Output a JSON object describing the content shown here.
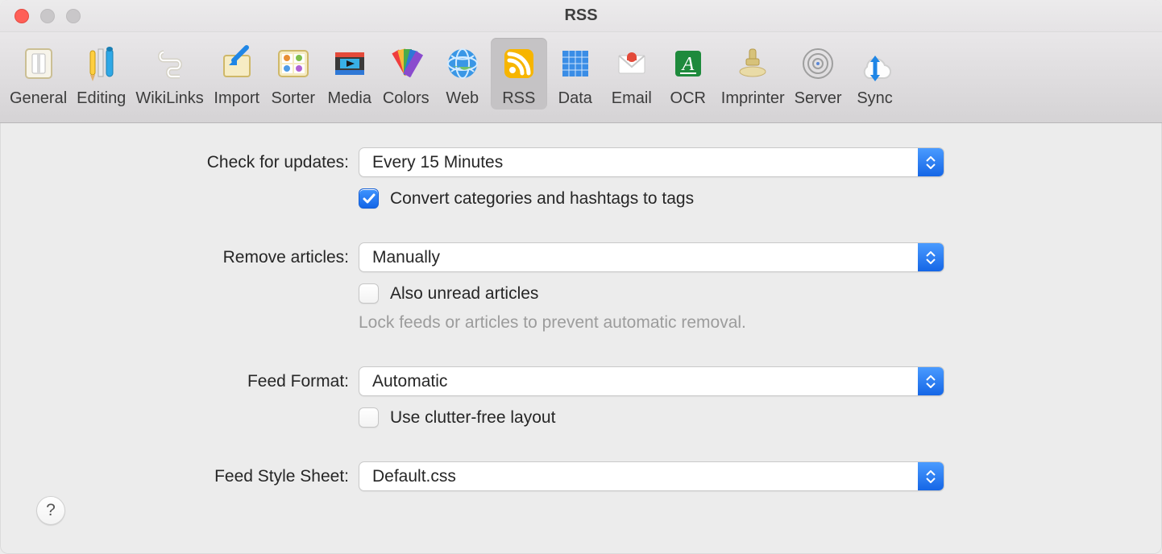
{
  "window": {
    "title": "RSS"
  },
  "toolbar": {
    "items": [
      {
        "id": "general",
        "label": "General"
      },
      {
        "id": "editing",
        "label": "Editing"
      },
      {
        "id": "wikilinks",
        "label": "WikiLinks"
      },
      {
        "id": "import",
        "label": "Import"
      },
      {
        "id": "sorter",
        "label": "Sorter"
      },
      {
        "id": "media",
        "label": "Media"
      },
      {
        "id": "colors",
        "label": "Colors"
      },
      {
        "id": "web",
        "label": "Web"
      },
      {
        "id": "rss",
        "label": "RSS"
      },
      {
        "id": "data",
        "label": "Data"
      },
      {
        "id": "email",
        "label": "Email"
      },
      {
        "id": "ocr",
        "label": "OCR"
      },
      {
        "id": "imprinter",
        "label": "Imprinter"
      },
      {
        "id": "server",
        "label": "Server"
      },
      {
        "id": "sync",
        "label": "Sync"
      }
    ],
    "selected_id": "rss"
  },
  "form": {
    "check_updates": {
      "label": "Check for updates:",
      "value": "Every 15 Minutes"
    },
    "convert_tags": {
      "label": "Convert categories and hashtags to tags",
      "checked": true
    },
    "remove_articles": {
      "label": "Remove articles:",
      "value": "Manually"
    },
    "also_unread": {
      "label": "Also unread articles",
      "checked": false
    },
    "hint": "Lock feeds or articles to prevent automatic removal.",
    "feed_format": {
      "label": "Feed Format:",
      "value": "Automatic"
    },
    "clutter_free": {
      "label": "Use clutter-free layout",
      "checked": false
    },
    "feed_style": {
      "label": "Feed Style Sheet:",
      "value": "Default.css"
    }
  },
  "help_button": "?"
}
